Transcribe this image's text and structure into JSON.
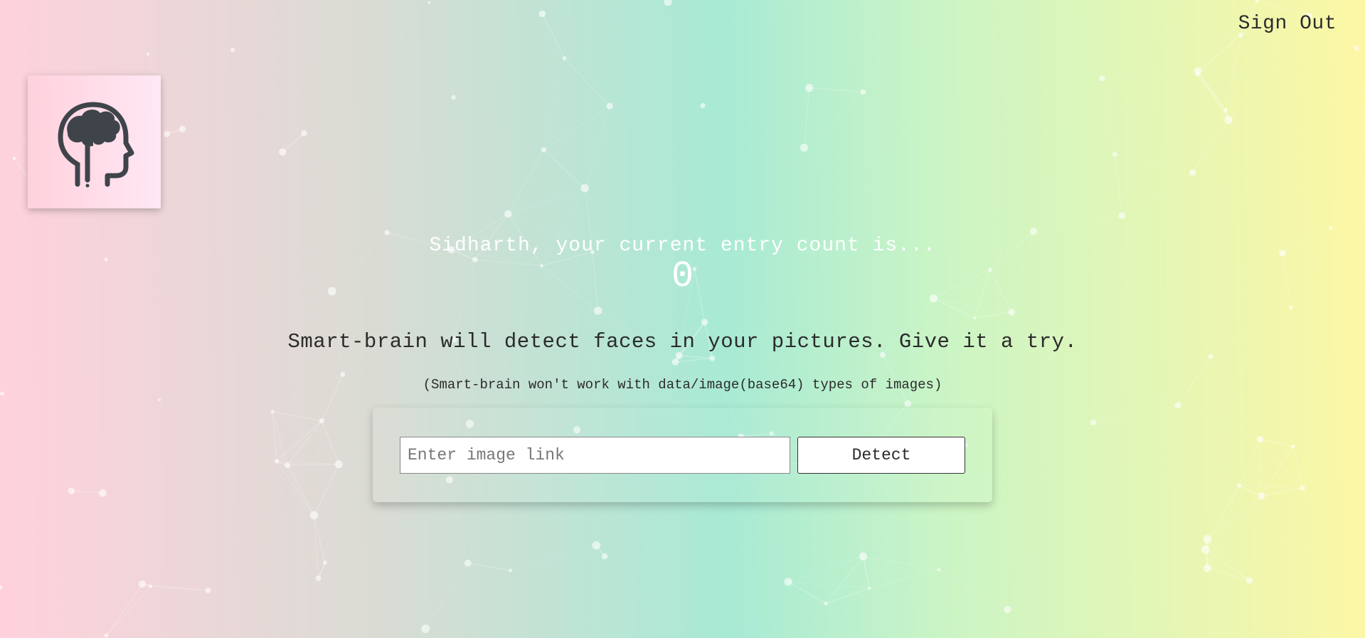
{
  "nav": {
    "sign_out_label": "Sign Out"
  },
  "logo": {
    "icon": "brain-head-icon"
  },
  "rank": {
    "label": "Sidharth, your current entry count is...",
    "count": "0"
  },
  "intro": {
    "text": "Smart-brain will detect faces in your pictures. Give it a try."
  },
  "note": {
    "text": "(Smart-brain won't work with data/image(base64) types of images)"
  },
  "form": {
    "input_placeholder": "Enter image link",
    "input_value": "",
    "detect_label": "Detect"
  },
  "colors": {
    "gradient_start": "#ffd1dc",
    "gradient_mid": "#a8ead5",
    "gradient_end": "#fdf7a5",
    "text": "#2b2b2b",
    "rank_text": "#ffffff",
    "logo_icon": "#3f444b"
  }
}
